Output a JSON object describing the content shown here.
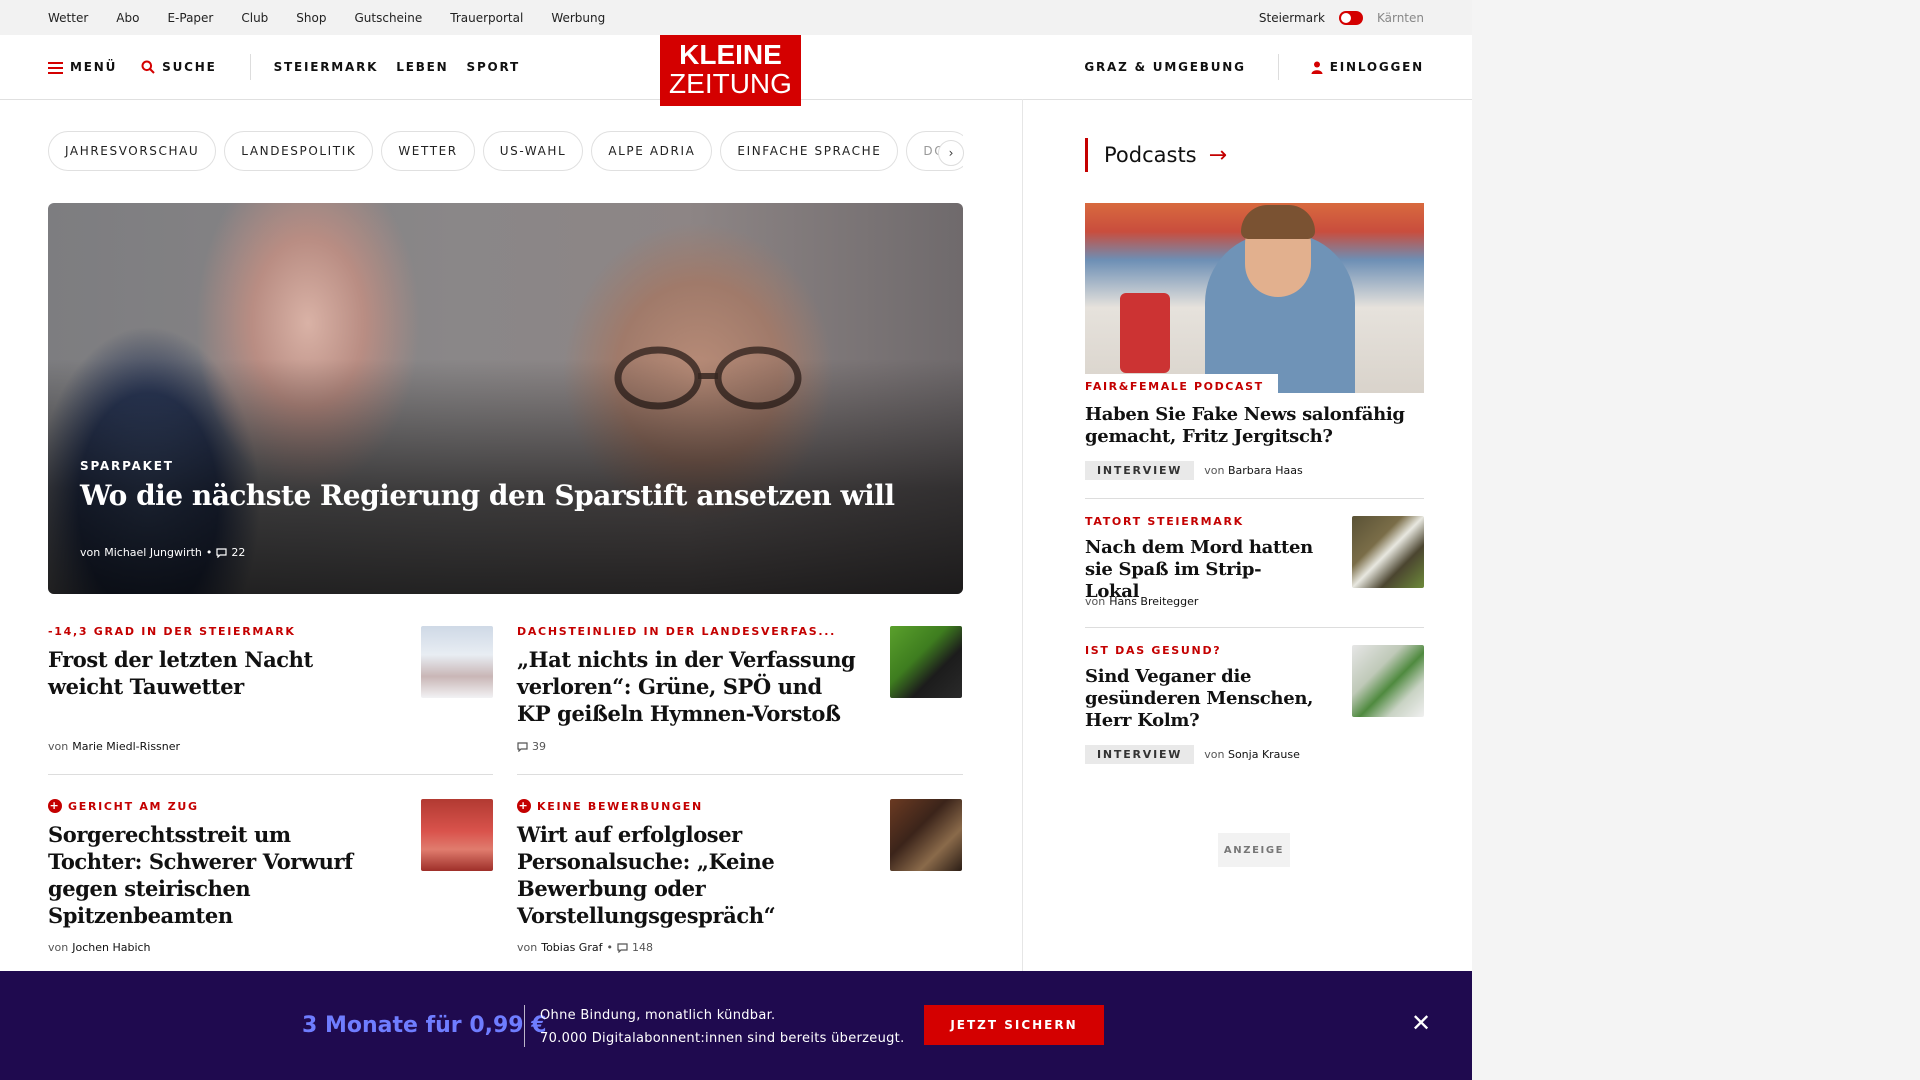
{
  "utility": {
    "links": [
      "Wetter",
      "Abo",
      "E-Paper",
      "Club",
      "Shop",
      "Gutscheine",
      "Trauerportal",
      "Werbung"
    ],
    "region_active": "Steiermark",
    "region_other": "Kärnten"
  },
  "header": {
    "menu": "MENÜ",
    "search": "SUCHE",
    "sections": [
      "STEIERMARK",
      "LEBEN",
      "SPORT"
    ],
    "logo_line1": "KLEINE",
    "logo_line2": "ZEITUNG",
    "local": "GRAZ & UMGEBUNG",
    "login": "EINLOGGEN"
  },
  "chips": [
    "JAHRESVORSCHAU",
    "LANDESPOLITIK",
    "WETTER",
    "US-WAHL",
    "ALPE ADRIA",
    "EINFACHE SPRACHE",
    "DOS"
  ],
  "hero": {
    "kicker": "SPARPAKET",
    "title": "Wo die nächste Regierung den Sparstift ansetzen will",
    "by_prefix": "von",
    "author": "Michael Jungwirth",
    "comments": "22"
  },
  "articles": [
    {
      "kicker": "-14,3 GRAD IN DER STEIERMARK",
      "headline": "Frost der letzten Nacht weicht Tauwetter",
      "by_prefix": "von",
      "author": "Marie Miedl-Rissner",
      "comments": "",
      "premium": false
    },
    {
      "kicker": "DACHSTEINLIED IN DER LANDESVERFAS...",
      "headline": "„Hat nichts in der Verfassung verloren“: Grüne, SPÖ und KP geißeln Hymnen-Vorstoß",
      "by_prefix": "",
      "author": "",
      "comments": "39",
      "premium": false
    },
    {
      "kicker": "GERICHT AM ZUG",
      "headline": "Sorgerechtsstreit um Tochter: Schwerer Vorwurf gegen steirischen Spitzenbeamten",
      "by_prefix": "von",
      "author": "Jochen Habich",
      "comments": "",
      "premium": true
    },
    {
      "kicker": "KEINE BEWERBUNGEN",
      "headline": "Wirt auf erfolgloser Personalsuche: „Keine Bewerbung oder Vorstellungsgespräch“",
      "by_prefix": "von",
      "author": "Tobias Graf",
      "comments": "148",
      "premium": true
    }
  ],
  "sidebar": {
    "title": "Podcasts",
    "featured": {
      "tag": "FAIR&FEMALE PODCAST",
      "headline": "Haben Sie Fake News salonfähig gemacht, Fritz Jergitsch?",
      "badge": "INTERVIEW",
      "by_prefix": "von",
      "author": "Barbara Haas"
    },
    "items": [
      {
        "kicker": "TATORT STEIERMARK",
        "headline": "Nach dem Mord hatten sie Spaß im Strip-Lokal",
        "badge": "",
        "by_prefix": "von",
        "author": "Hans Breitegger"
      },
      {
        "kicker": "IST DAS GESUND?",
        "headline": "Sind Veganer die gesünderen Menschen, Herr Kolm?",
        "badge": "INTERVIEW",
        "by_prefix": "von",
        "author": "Sonja Krause"
      }
    ],
    "ad_label": "ANZEIGE"
  },
  "promo": {
    "offer": "3 Monate für 0,99 €",
    "line1": "Ohne Bindung, monatlich kündbar.",
    "line2": "70.000 Digitalabonnent:innen sind bereits überzeugt.",
    "cta": "JETZT SICHERN"
  },
  "colors": {
    "brand_red": "#d40000",
    "promo_bg": "#1f0a4f",
    "promo_accent": "#6f7dff"
  }
}
